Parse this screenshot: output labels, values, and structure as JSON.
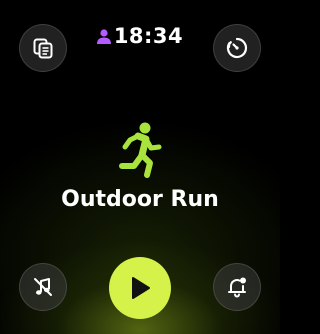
{
  "status_bar": {
    "time": "18:34",
    "accent_color": "#b45cff"
  },
  "workout": {
    "title": "Outdoor Run",
    "icon": "running-figure-icon",
    "accent_color": "#a9e43c"
  },
  "buttons": {
    "top_left_icon": "multi-page-icon",
    "top_right_icon": "stopwatch-icon",
    "bottom_left_icon": "music-off-icon",
    "bottom_right_icon": "bell-alert-icon",
    "play_icon": "play-icon",
    "play_color": "#d4f24a"
  }
}
